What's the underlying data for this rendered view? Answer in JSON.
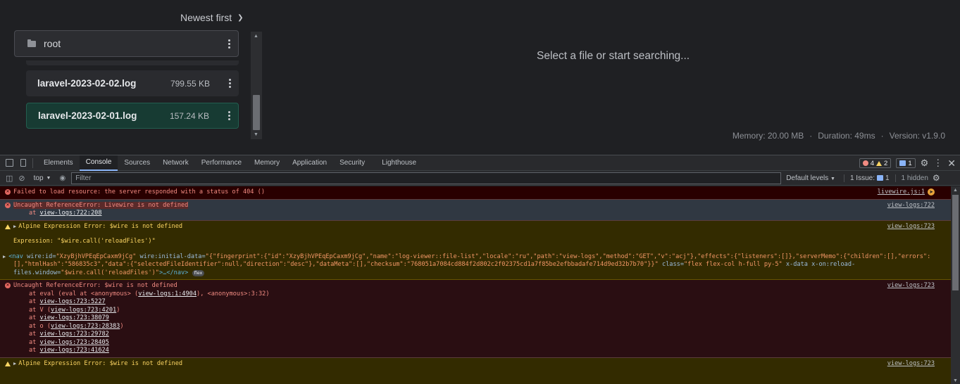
{
  "app": {
    "sort_label": "Newest first",
    "root_label": "root",
    "files": [
      {
        "name": "laravel-2023-02-02.log",
        "size": "799.55 KB",
        "selected": false
      },
      {
        "name": "laravel-2023-02-01.log",
        "size": "157.24 KB",
        "selected": true
      }
    ],
    "empty_state": "Select a file or start searching...",
    "footer": {
      "memory": "Memory: 20.00 MB",
      "duration": "Duration: 49ms",
      "version": "Version: v1.9.0",
      "dot": "·"
    }
  },
  "devtools": {
    "tabs": [
      "Elements",
      "Console",
      "Sources",
      "Network",
      "Performance",
      "Memory",
      "Application",
      "Security",
      "Lighthouse"
    ],
    "active_tab": "Console",
    "error_count": "4",
    "warning_count": "2",
    "message_count": "1",
    "context": "top",
    "filter_placeholder": "Filter",
    "levels": "Default levels",
    "issues_label": "1 Issue:",
    "issues_count": "1",
    "hidden_label": "1 hidden",
    "colors": {
      "error_bg": "#290000",
      "warn_bg": "#332b00",
      "error_text": "#f28b82",
      "warn_text": "#fdd663"
    }
  },
  "console": {
    "m1": {
      "text": "Failed to load resource: the server responded with a status of 404 ()",
      "source": "livewire.js:1"
    },
    "m2": {
      "text": "Uncaught ReferenceError: Livewire is not defined",
      "at": "at ",
      "link": "view-logs:722:208",
      "source": "view-logs:722"
    },
    "m3": {
      "text": "Alpine Expression Error: $wire is not defined",
      "source": "view-logs:723",
      "expression": "Expression: \"$wire.call('reloadFiles')\"",
      "nav_open": "<nav",
      "nav_attr1": " wire:id=",
      "nav_val1": "\"XzyBjhVPEqEpCaxm9jCg\"",
      "nav_attr2": " wire:initial-data=",
      "nav_val2": "\"{\"fingerprint\":{\"id\":\"XzyBjhVPEqEpCaxm9jCg\",\"name\":\"log-viewer::file-list\",\"locale\":\"ru\",\"path\":\"view-logs\",\"method\":\"GET\",\"v\":\"acj\"},\"effects\":{\"listeners\":[]},\"serverMemo\":{\"children\":[],\"errors\":[],\"htmlHash\":\"586835c3\",\"data\":{\"selectedFileIdentifier\":null,\"direction\":\"desc\"},\"dataMeta\":[],\"checksum\":\"768051a7084cd884f2d802c2f02375cd1a7f85be2efbbadafe714d9ed32b7b70\"}}\"",
      "nav_attr3": " class=",
      "nav_val3": "\"flex flex-col h-full py-5\"",
      "nav_attr4": " x-data x-on:reload-files.window=",
      "nav_val4": "\"$wire.call('reloadFiles')\"",
      "nav_close": ">…</nav>",
      "flex_badge": "flex"
    },
    "m4": {
      "text": "Uncaught ReferenceError: $wire is not defined",
      "source": "view-logs:723",
      "eval_pre": "at eval (eval at <anonymous> (",
      "eval_link": "view-logs:1:4904",
      "eval_post": "), <anonymous>:3:32)",
      "frames": [
        {
          "pre": "at ",
          "link": "view-logs:723:5227",
          "post": ""
        },
        {
          "pre": "at V (",
          "link": "view-logs:723:4201",
          "post": ")"
        },
        {
          "pre": "at ",
          "link": "view-logs:723:38079",
          "post": ""
        },
        {
          "pre": "at o (",
          "link": "view-logs:723:28383",
          "post": ")"
        },
        {
          "pre": "at ",
          "link": "view-logs:723:29782",
          "post": ""
        },
        {
          "pre": "at ",
          "link": "view-logs:723:28405",
          "post": ""
        },
        {
          "pre": "at ",
          "link": "view-logs:723:41624",
          "post": ""
        }
      ]
    },
    "m5": {
      "text": "Alpine Expression Error: $wire is not defined",
      "source": "view-logs:723"
    }
  }
}
